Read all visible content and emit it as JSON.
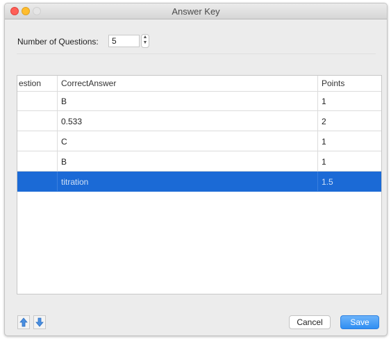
{
  "window": {
    "title": "Answer Key"
  },
  "form": {
    "num_questions_label": "Number of Questions:",
    "num_questions_value": "5"
  },
  "table": {
    "headers": [
      "estion",
      "CorrectAnswer",
      "Points"
    ],
    "rows": [
      {
        "question": "",
        "answer": "B",
        "points": "1"
      },
      {
        "question": "",
        "answer": "0.533",
        "points": "2"
      },
      {
        "question": "",
        "answer": "C",
        "points": "1"
      },
      {
        "question": "",
        "answer": "B",
        "points": "1"
      },
      {
        "question": "",
        "answer": "titration",
        "points": "1.5"
      }
    ],
    "selected_row_index": 4
  },
  "footer": {
    "move_up_icon": "arrow-up-icon",
    "move_down_icon": "arrow-down-icon",
    "cancel_label": "Cancel",
    "save_label": "Save"
  },
  "colors": {
    "selection": "#1b6ad6",
    "primary_button": "#2f8ef2",
    "close": "#ff5f57",
    "minimize": "#ffbd2e"
  }
}
